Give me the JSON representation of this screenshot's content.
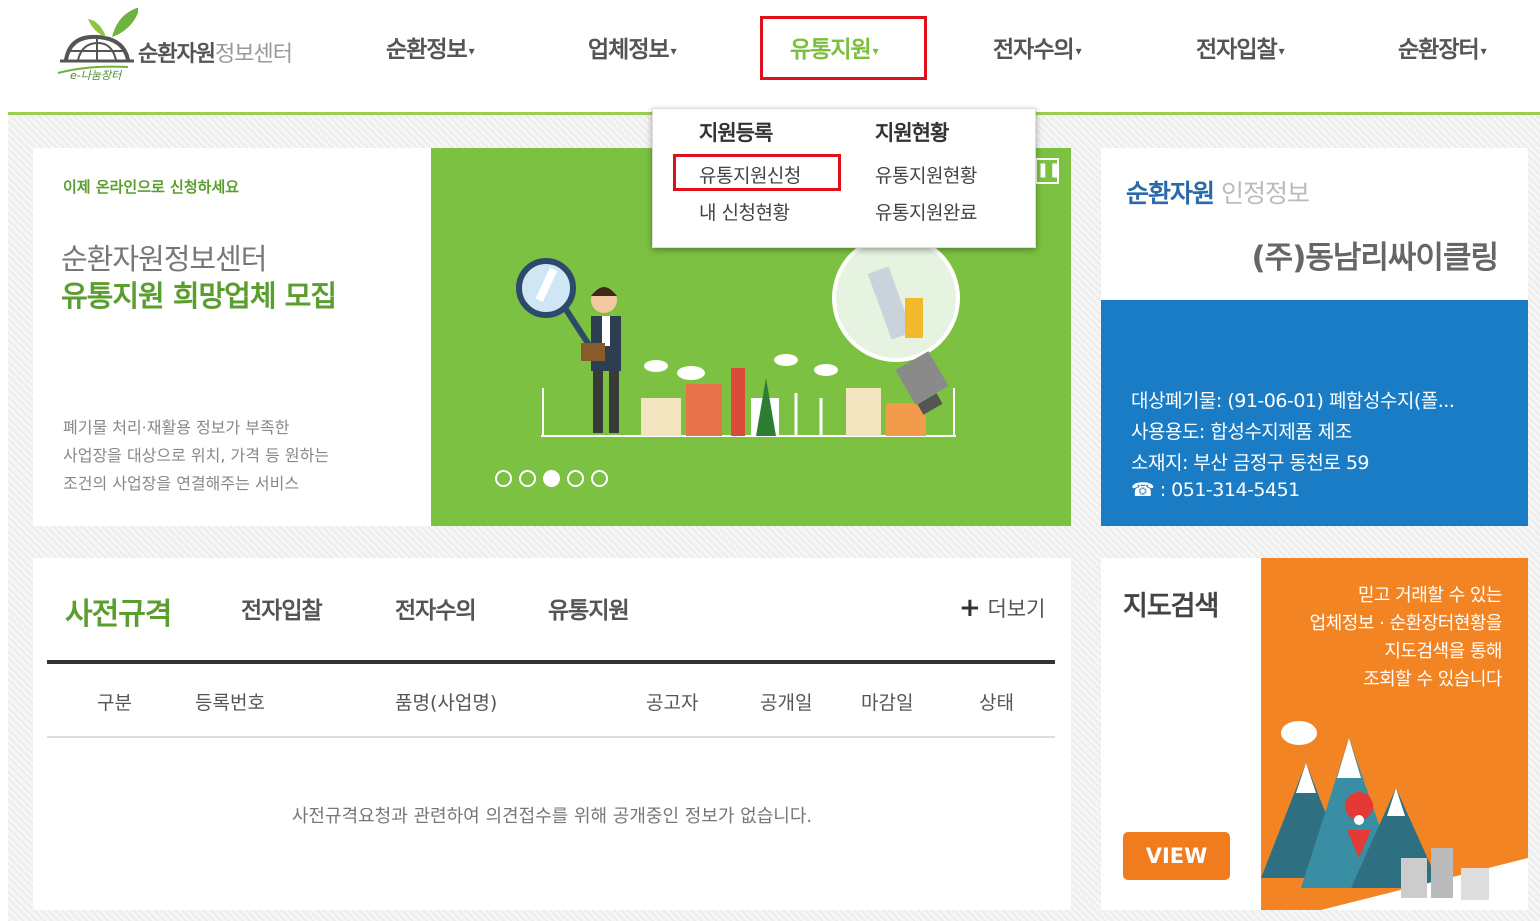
{
  "header": {
    "logo_main": "순환자원",
    "logo_light": "정보센터",
    "logo_sub": "e-나눔장터",
    "nav": [
      {
        "label": "순환정보"
      },
      {
        "label": "업체정보"
      },
      {
        "label": "유통지원"
      },
      {
        "label": "전자수의"
      },
      {
        "label": "전자입찰"
      },
      {
        "label": "순환장터"
      }
    ]
  },
  "dropdown": {
    "col1_title": "지원등록",
    "col1_items": [
      "유통지원신청",
      "내 신청현황"
    ],
    "col2_title": "지원현황",
    "col2_items": [
      "유통지원현황",
      "유통지원완료"
    ]
  },
  "hero": {
    "tag": "이제 온라인으로 신청하세요",
    "title1": "순환자원정보센터",
    "title2": "유통지원 희망업체 모집",
    "desc": [
      "폐기물 처리·재활용 정보가 부족한",
      "사업장을 대상으로 위치, 가격 등 원하는",
      "조건의 사업장을 연결해주는 서비스"
    ]
  },
  "cert": {
    "title_bold": "순환자원",
    "title_light": "인정정보",
    "company": "(주)동남리싸이클링",
    "waste": "대상폐기물: (91-06-01) 폐합성수지(폴...",
    "use": "사용용도: 합성수지제품 제조",
    "address": "소재지: 부산 금정구 동천로 59",
    "phone": "☎ : 051-314-5451"
  },
  "board": {
    "tabs": [
      "사전규격",
      "전자입찰",
      "전자수의",
      "유통지원"
    ],
    "more": "더보기",
    "columns": [
      "구분",
      "등록번호",
      "품명(사업명)",
      "공고자",
      "공개일",
      "마감일",
      "상태"
    ],
    "empty": "사전규격요청과 관련하여 의견접수를 위해 공개중인 정보가 없습니다."
  },
  "map": {
    "title": "지도검색",
    "desc": [
      "믿고 거래할 수 있는",
      "업체정보 · 순환장터현황을",
      "지도검색을 통해",
      "조회할 수 있습니다"
    ],
    "view": "VIEW"
  },
  "colors": {
    "green": "#7cbf3b",
    "blue": "#1a7cc4",
    "orange": "#f38424",
    "highlight": "#e0101a"
  }
}
